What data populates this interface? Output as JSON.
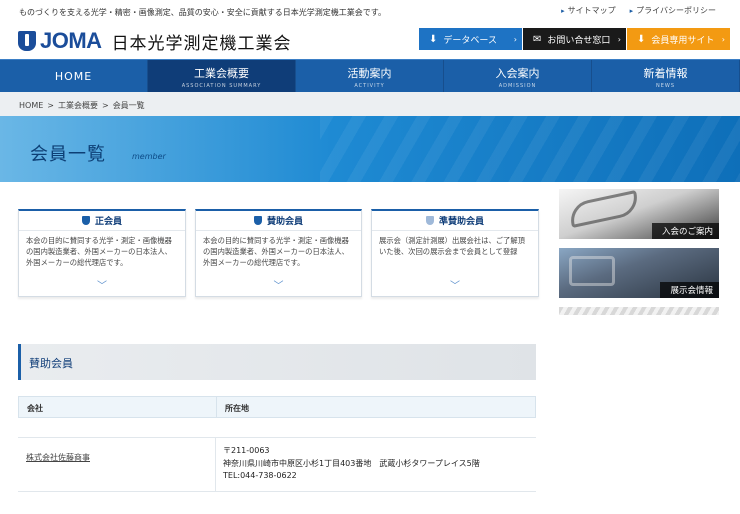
{
  "header": {
    "tagline": "ものづくりを支える光学・精密・画像測定、品質の安心・安全に貢献する日本光学測定機工業会です。",
    "links": [
      "サイトマップ",
      "プライバシーポリシー"
    ],
    "logo_text": "JOMA",
    "org_name": "日本光学測定機工業会",
    "buttons": {
      "database": "データベース",
      "contact": "お問い合せ窓口",
      "members_site": "会員専用サイト"
    }
  },
  "nav": [
    {
      "label": "HOME",
      "sub": ""
    },
    {
      "label": "工業会概要",
      "sub": "ASSOCIATION SUMMARY"
    },
    {
      "label": "活動案内",
      "sub": "ACTIVITY"
    },
    {
      "label": "入会案内",
      "sub": "ADMISSION"
    },
    {
      "label": "新着情報",
      "sub": "NEWS"
    }
  ],
  "breadcrumb": [
    "HOME",
    "工業会概要",
    "会員一覧"
  ],
  "banner": {
    "title": "会員一覧",
    "subtitle": "member"
  },
  "cards": [
    {
      "title": "正会員",
      "text": "本会の目的に賛同する光学・測定・画像機器の国内製造業者、外国メーカーの日本法人、外国メーカーの総代理店です。"
    },
    {
      "title": "賛助会員",
      "text": "本会の目的に賛同する光学・測定・画像機器の国内製造業者、外国メーカーの日本法人、外国メーカーの総代理店です。"
    },
    {
      "title": "準賛助会員",
      "text": "展示会（測定計測展）出展会社は、ご了解頂いた後、次回の展示会まで会員として登録"
    }
  ],
  "side": {
    "join_label": "入会のご案内",
    "expo_label": "展示会情報"
  },
  "section": {
    "title": "賛助会員",
    "col_company": "会社",
    "col_address": "所在地"
  },
  "rows": [
    {
      "company": "株式会社佐藤商事",
      "postal": "〒211-0063",
      "address": "神奈川県川崎市中原区小杉1丁目403番地　武蔵小杉タワープレイス5階",
      "tel": "TEL:044-738-0622"
    }
  ],
  "colors": {
    "brand": "#1b5fa8",
    "accent": "#f39a12"
  }
}
